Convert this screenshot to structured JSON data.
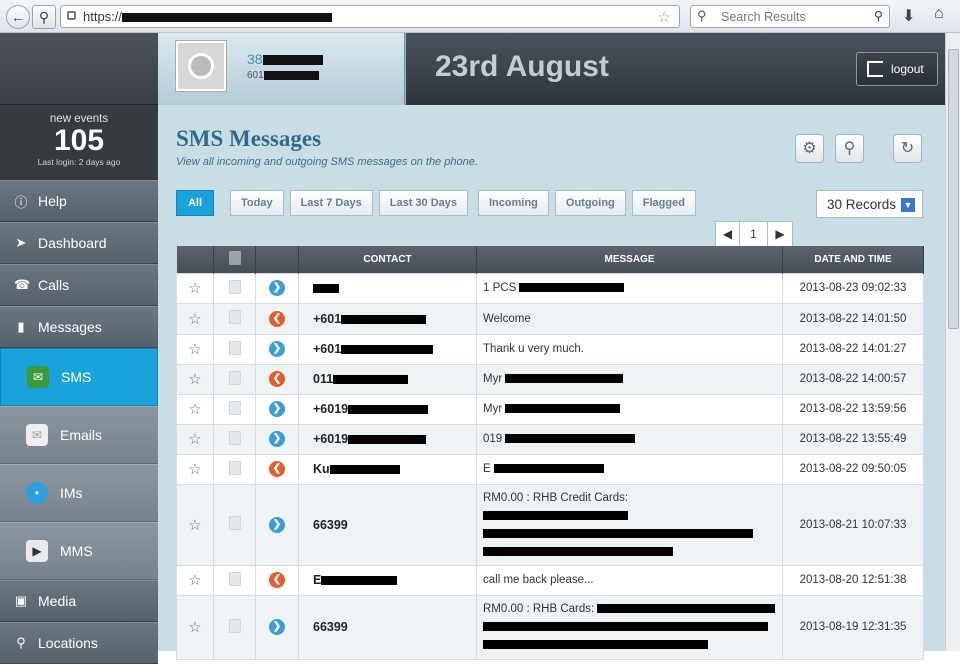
{
  "browser": {
    "url_prefix": "https://",
    "search_placeholder": "Search Results"
  },
  "sidebar": {
    "events_label": "new events",
    "events_count": "105",
    "last_login": "Last login: 2 days ago",
    "items": [
      {
        "label": "Help",
        "icon": "info-icon"
      },
      {
        "label": "Dashboard",
        "icon": "rocket-icon"
      },
      {
        "label": "Calls",
        "icon": "phone-icon"
      },
      {
        "label": "Messages",
        "icon": "chat-icon"
      }
    ],
    "sub_items": [
      {
        "label": "SMS",
        "icon": "sms-icon"
      },
      {
        "label": "Emails",
        "icon": "envelope-icon"
      },
      {
        "label": "IMs",
        "icon": "bubble-icon"
      },
      {
        "label": "MMS",
        "icon": "media-icon"
      }
    ],
    "bottom_items": [
      {
        "label": "Media",
        "icon": "picture-icon"
      },
      {
        "label": "Locations",
        "icon": "pin-icon"
      }
    ]
  },
  "header": {
    "phone_line1": "38",
    "phone_line2": "601",
    "date": "23rd August",
    "logout": "logout"
  },
  "page": {
    "title": "SMS Messages",
    "subtitle": "View all incoming and outgoing SMS messages on the phone."
  },
  "filters": [
    "All",
    "Today",
    "Last 7 Days",
    "Last 30 Days",
    "Incoming",
    "Outgoing",
    "Flagged"
  ],
  "records": "30 Records",
  "pager": {
    "page": "1"
  },
  "table": {
    "headers": {
      "contact": "CONTACT",
      "message": "MESSAGE",
      "date": "DATE AND TIME"
    },
    "rows": [
      {
        "dir": "in",
        "contact": "",
        "message": "1 PCS",
        "date": "2013-08-23 09:02:33"
      },
      {
        "dir": "out",
        "contact": "+601",
        "message": "Welcome",
        "date": "2013-08-22 14:01:50"
      },
      {
        "dir": "in",
        "contact": "+601",
        "message": "Thank u very much.",
        "date": "2013-08-22 14:01:27"
      },
      {
        "dir": "out",
        "contact": "011",
        "message": "Myr",
        "date": "2013-08-22 14:00:57"
      },
      {
        "dir": "in",
        "contact": "+6019",
        "message": "Myr",
        "date": "2013-08-22 13:59:56"
      },
      {
        "dir": "in",
        "contact": "+6019",
        "message": "019",
        "date": "2013-08-22 13:55:49"
      },
      {
        "dir": "out",
        "contact": "Ku",
        "message": "E",
        "date": "2013-08-22 09:50:05"
      },
      {
        "dir": "in",
        "contact": "66399",
        "message": "RM0.00 : RHB Credit Cards:",
        "date": "2013-08-21 10:07:33"
      },
      {
        "dir": "out",
        "contact": "E",
        "message": "call me back please...",
        "date": "2013-08-20 12:51:38"
      },
      {
        "dir": "in",
        "contact": "66399",
        "message": "RM0.00 : RHB Cards:",
        "date": "2013-08-19 12:31:35"
      }
    ]
  }
}
